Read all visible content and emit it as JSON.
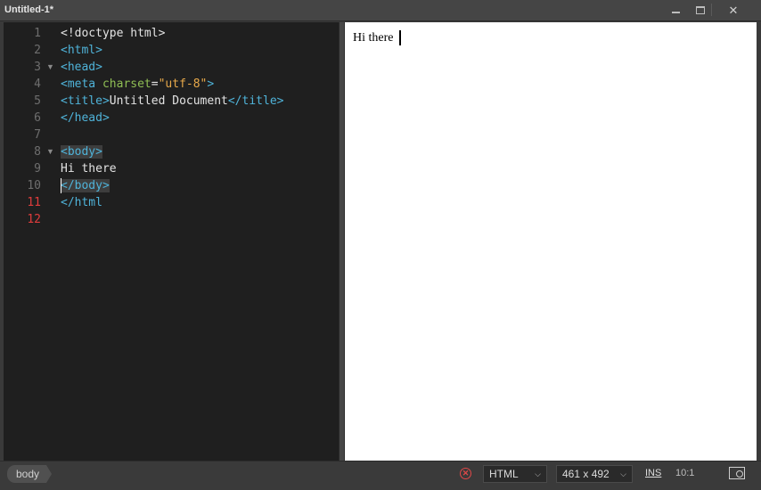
{
  "window": {
    "title": "Untitled-1*"
  },
  "editor": {
    "line_numbers": [
      "1",
      "2",
      "3",
      "4",
      "5",
      "6",
      "7",
      "8",
      "9",
      "10",
      "11",
      "12"
    ],
    "lines": {
      "l1": {
        "text": "<!doctype html>"
      },
      "l2": {
        "open": "<html>"
      },
      "l3": {
        "open": "<head>"
      },
      "l4": {
        "tag": "<meta",
        "attr": " charset",
        "eq": "=",
        "val": "\"utf-8\"",
        "close": ">"
      },
      "l5": {
        "open": "<title>",
        "text": "Untitled Document",
        "close": "</title>"
      },
      "l6": {
        "close": "</head>"
      },
      "l8": {
        "open": "<body>"
      },
      "l9": {
        "text": "Hi there"
      },
      "l10": {
        "close": "</body>"
      },
      "l11": {
        "close": "</html"
      }
    }
  },
  "preview": {
    "text": "Hi there"
  },
  "status": {
    "tag_crumb": "body",
    "language": "HTML",
    "window_size": "461 x 492",
    "mode": "INS",
    "cursor_pos": "10:1"
  }
}
